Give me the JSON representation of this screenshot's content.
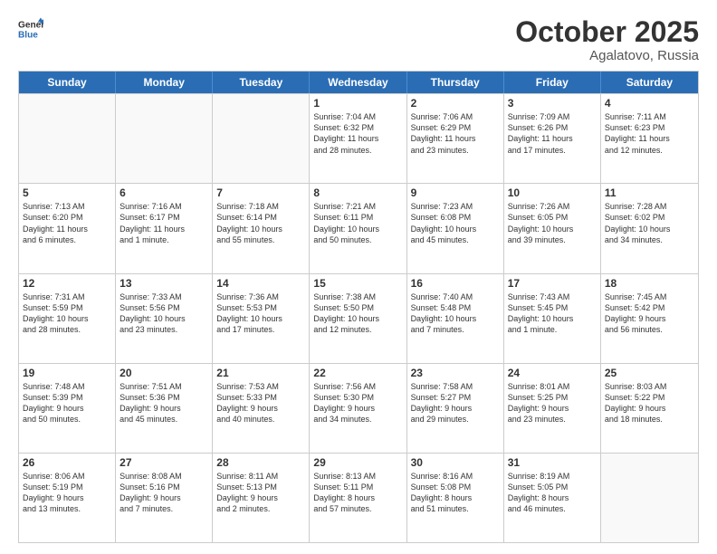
{
  "header": {
    "logo_general": "General",
    "logo_blue": "Blue",
    "month": "October 2025",
    "location": "Agalatovo, Russia"
  },
  "days_of_week": [
    "Sunday",
    "Monday",
    "Tuesday",
    "Wednesday",
    "Thursday",
    "Friday",
    "Saturday"
  ],
  "weeks": [
    [
      {
        "day": "",
        "info": ""
      },
      {
        "day": "",
        "info": ""
      },
      {
        "day": "",
        "info": ""
      },
      {
        "day": "1",
        "info": "Sunrise: 7:04 AM\nSunset: 6:32 PM\nDaylight: 11 hours\nand 28 minutes."
      },
      {
        "day": "2",
        "info": "Sunrise: 7:06 AM\nSunset: 6:29 PM\nDaylight: 11 hours\nand 23 minutes."
      },
      {
        "day": "3",
        "info": "Sunrise: 7:09 AM\nSunset: 6:26 PM\nDaylight: 11 hours\nand 17 minutes."
      },
      {
        "day": "4",
        "info": "Sunrise: 7:11 AM\nSunset: 6:23 PM\nDaylight: 11 hours\nand 12 minutes."
      }
    ],
    [
      {
        "day": "5",
        "info": "Sunrise: 7:13 AM\nSunset: 6:20 PM\nDaylight: 11 hours\nand 6 minutes."
      },
      {
        "day": "6",
        "info": "Sunrise: 7:16 AM\nSunset: 6:17 PM\nDaylight: 11 hours\nand 1 minute."
      },
      {
        "day": "7",
        "info": "Sunrise: 7:18 AM\nSunset: 6:14 PM\nDaylight: 10 hours\nand 55 minutes."
      },
      {
        "day": "8",
        "info": "Sunrise: 7:21 AM\nSunset: 6:11 PM\nDaylight: 10 hours\nand 50 minutes."
      },
      {
        "day": "9",
        "info": "Sunrise: 7:23 AM\nSunset: 6:08 PM\nDaylight: 10 hours\nand 45 minutes."
      },
      {
        "day": "10",
        "info": "Sunrise: 7:26 AM\nSunset: 6:05 PM\nDaylight: 10 hours\nand 39 minutes."
      },
      {
        "day": "11",
        "info": "Sunrise: 7:28 AM\nSunset: 6:02 PM\nDaylight: 10 hours\nand 34 minutes."
      }
    ],
    [
      {
        "day": "12",
        "info": "Sunrise: 7:31 AM\nSunset: 5:59 PM\nDaylight: 10 hours\nand 28 minutes."
      },
      {
        "day": "13",
        "info": "Sunrise: 7:33 AM\nSunset: 5:56 PM\nDaylight: 10 hours\nand 23 minutes."
      },
      {
        "day": "14",
        "info": "Sunrise: 7:36 AM\nSunset: 5:53 PM\nDaylight: 10 hours\nand 17 minutes."
      },
      {
        "day": "15",
        "info": "Sunrise: 7:38 AM\nSunset: 5:50 PM\nDaylight: 10 hours\nand 12 minutes."
      },
      {
        "day": "16",
        "info": "Sunrise: 7:40 AM\nSunset: 5:48 PM\nDaylight: 10 hours\nand 7 minutes."
      },
      {
        "day": "17",
        "info": "Sunrise: 7:43 AM\nSunset: 5:45 PM\nDaylight: 10 hours\nand 1 minute."
      },
      {
        "day": "18",
        "info": "Sunrise: 7:45 AM\nSunset: 5:42 PM\nDaylight: 9 hours\nand 56 minutes."
      }
    ],
    [
      {
        "day": "19",
        "info": "Sunrise: 7:48 AM\nSunset: 5:39 PM\nDaylight: 9 hours\nand 50 minutes."
      },
      {
        "day": "20",
        "info": "Sunrise: 7:51 AM\nSunset: 5:36 PM\nDaylight: 9 hours\nand 45 minutes."
      },
      {
        "day": "21",
        "info": "Sunrise: 7:53 AM\nSunset: 5:33 PM\nDaylight: 9 hours\nand 40 minutes."
      },
      {
        "day": "22",
        "info": "Sunrise: 7:56 AM\nSunset: 5:30 PM\nDaylight: 9 hours\nand 34 minutes."
      },
      {
        "day": "23",
        "info": "Sunrise: 7:58 AM\nSunset: 5:27 PM\nDaylight: 9 hours\nand 29 minutes."
      },
      {
        "day": "24",
        "info": "Sunrise: 8:01 AM\nSunset: 5:25 PM\nDaylight: 9 hours\nand 23 minutes."
      },
      {
        "day": "25",
        "info": "Sunrise: 8:03 AM\nSunset: 5:22 PM\nDaylight: 9 hours\nand 18 minutes."
      }
    ],
    [
      {
        "day": "26",
        "info": "Sunrise: 8:06 AM\nSunset: 5:19 PM\nDaylight: 9 hours\nand 13 minutes."
      },
      {
        "day": "27",
        "info": "Sunrise: 8:08 AM\nSunset: 5:16 PM\nDaylight: 9 hours\nand 7 minutes."
      },
      {
        "day": "28",
        "info": "Sunrise: 8:11 AM\nSunset: 5:13 PM\nDaylight: 9 hours\nand 2 minutes."
      },
      {
        "day": "29",
        "info": "Sunrise: 8:13 AM\nSunset: 5:11 PM\nDaylight: 8 hours\nand 57 minutes."
      },
      {
        "day": "30",
        "info": "Sunrise: 8:16 AM\nSunset: 5:08 PM\nDaylight: 8 hours\nand 51 minutes."
      },
      {
        "day": "31",
        "info": "Sunrise: 8:19 AM\nSunset: 5:05 PM\nDaylight: 8 hours\nand 46 minutes."
      },
      {
        "day": "",
        "info": ""
      }
    ]
  ]
}
